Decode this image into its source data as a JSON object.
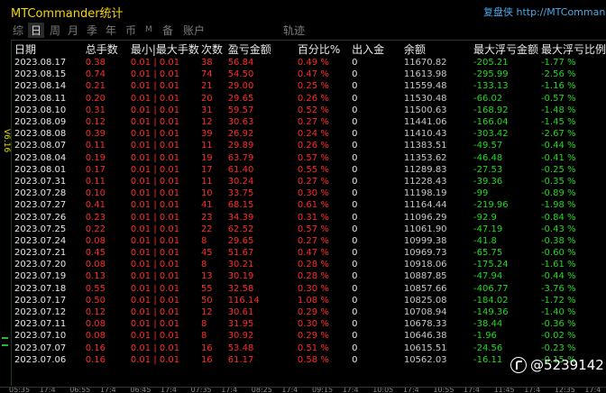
{
  "titlebar": {
    "app_title": "MTCommander统计",
    "replay_link": "复盘侠 http://MTCommander"
  },
  "tabs": [
    {
      "label": "综",
      "active": false
    },
    {
      "label": "日",
      "active": true
    },
    {
      "label": "周",
      "active": false
    },
    {
      "label": "月",
      "active": false
    },
    {
      "label": "季",
      "active": false
    },
    {
      "label": "年",
      "active": false
    },
    {
      "label": "币",
      "active": false
    },
    {
      "label": "M",
      "active": false
    },
    {
      "label": "备",
      "active": false
    },
    {
      "label": "账户",
      "active": false
    },
    {
      "label": "轨迹",
      "active": false
    }
  ],
  "left_strip_label": "V6.16",
  "table": {
    "headers": [
      "日期",
      "总手数",
      "最小|最大手数",
      "次数",
      "盈亏金额",
      "百分比%",
      "出入金",
      "余额",
      "最大浮亏金额",
      "最大浮亏比例"
    ],
    "rows": [
      [
        "2023.08.17",
        "0.38",
        "0.01 | 0.01",
        "38",
        "56.84",
        "0.49 %",
        "0",
        "11670.82",
        "-205.21",
        "-1.77 %"
      ],
      [
        "2023.08.15",
        "0.74",
        "0.01 | 0.01",
        "74",
        "54.50",
        "0.47 %",
        "0",
        "11613.98",
        "-295.99",
        "-2.56 %"
      ],
      [
        "2023.08.14",
        "0.21",
        "0.01 | 0.01",
        "21",
        "29.00",
        "0.25 %",
        "0",
        "11559.48",
        "-133.13",
        "-1.16 %"
      ],
      [
        "2023.08.11",
        "0.20",
        "0.01 | 0.01",
        "20",
        "29.65",
        "0.26 %",
        "0",
        "11530.48",
        "-66.02",
        "-0.57 %"
      ],
      [
        "2023.08.10",
        "0.31",
        "0.01 | 0.01",
        "31",
        "59.57",
        "0.52 %",
        "0",
        "11500.63",
        "-168.92",
        "-1.48 %"
      ],
      [
        "2023.08.09",
        "0.12",
        "0.01 | 0.01",
        "12",
        "30.63",
        "0.27 %",
        "0",
        "11441.06",
        "-166.04",
        "-1.45 %"
      ],
      [
        "2023.08.08",
        "0.39",
        "0.01 | 0.01",
        "39",
        "26.92",
        "0.24 %",
        "0",
        "11410.43",
        "-303.42",
        "-2.67 %"
      ],
      [
        "2023.08.07",
        "0.11",
        "0.01 | 0.01",
        "11",
        "29.89",
        "0.26 %",
        "0",
        "11383.51",
        "-49.57",
        "-0.44 %"
      ],
      [
        "2023.08.04",
        "0.19",
        "0.01 | 0.01",
        "19",
        "63.79",
        "0.57 %",
        "0",
        "11353.62",
        "-46.48",
        "-0.41 %"
      ],
      [
        "2023.08.01",
        "0.17",
        "0.01 | 0.01",
        "17",
        "61.40",
        "0.55 %",
        "0",
        "11289.83",
        "-27.53",
        "-0.25 %"
      ],
      [
        "2023.07.31",
        "0.11",
        "0.01 | 0.01",
        "11",
        "30.24",
        "0.27 %",
        "0",
        "11228.43",
        "-39.36",
        "-0.35 %"
      ],
      [
        "2023.07.28",
        "0.10",
        "0.01 | 0.01",
        "10",
        "33.75",
        "0.30 %",
        "0",
        "11198.19",
        "-99",
        "-0.89 %"
      ],
      [
        "2023.07.27",
        "0.41",
        "0.01 | 0.01",
        "41",
        "68.15",
        "0.61 %",
        "0",
        "11164.44",
        "-219.96",
        "-1.98 %"
      ],
      [
        "2023.07.26",
        "0.23",
        "0.01 | 0.01",
        "23",
        "34.39",
        "0.31 %",
        "0",
        "11096.29",
        "-92.9",
        "-0.84 %"
      ],
      [
        "2023.07.25",
        "0.22",
        "0.01 | 0.01",
        "22",
        "62.52",
        "0.57 %",
        "0",
        "11061.90",
        "-47.19",
        "-0.43 %"
      ],
      [
        "2023.07.24",
        "0.08",
        "0.01 | 0.01",
        "8",
        "29.65",
        "0.27 %",
        "0",
        "10999.38",
        "-41.8",
        "-0.38 %"
      ],
      [
        "2023.07.21",
        "0.45",
        "0.01 | 0.01",
        "45",
        "51.67",
        "0.47 %",
        "0",
        "10969.73",
        "-65.75",
        "-0.60 %"
      ],
      [
        "2023.07.20",
        "0.08",
        "0.01 | 0.01",
        "8",
        "30.21",
        "0.28 %",
        "0",
        "10918.06",
        "-175.24",
        "-1.61 %"
      ],
      [
        "2023.07.19",
        "0.13",
        "0.01 | 0.01",
        "13",
        "30.19",
        "0.28 %",
        "0",
        "10887.85",
        "-47.94",
        "-0.44 %"
      ],
      [
        "2023.07.18",
        "0.55",
        "0.01 | 0.01",
        "55",
        "32.58",
        "0.30 %",
        "0",
        "10857.66",
        "-406.77",
        "-3.76 %"
      ],
      [
        "2023.07.17",
        "0.50",
        "0.01 | 0.01",
        "50",
        "116.14",
        "1.08 %",
        "0",
        "10825.08",
        "-184.02",
        "-1.72 %"
      ],
      [
        "2023.07.12",
        "0.12",
        "0.01 | 0.01",
        "12",
        "30.61",
        "0.29 %",
        "0",
        "10708.94",
        "-149.36",
        "-1.40 %"
      ],
      [
        "2023.07.11",
        "0.08",
        "0.01 | 0.01",
        "8",
        "31.95",
        "0.30 %",
        "0",
        "10678.33",
        "-38.44",
        "-0.36 %"
      ],
      [
        "2023.07.10",
        "0.08",
        "0.01 | 0.01",
        "8",
        "30.92",
        "0.29 %",
        "0",
        "10646.38",
        "-1.96",
        "-0.02 %"
      ],
      [
        "2023.07.07",
        "0.16",
        "0.01 | 0.01",
        "16",
        "53.48",
        "0.51 %",
        "0",
        "10615.51",
        "-24.56",
        "-0.23 %"
      ],
      [
        "2023.07.06",
        "0.16",
        "0.01 | 0.01",
        "16",
        "61.17",
        "0.58 %",
        "0",
        "10562.03",
        "-16.11",
        "-0.15 %"
      ]
    ]
  },
  "time_axis": [
    "05:35",
    "17:4",
    "06:55",
    "17:4",
    "06:45",
    "17:4",
    "07:35",
    "17:4",
    "08:25",
    "17:4",
    "09:15",
    "17:4",
    "10:05",
    "17:4",
    "10:55",
    "17:4",
    "11:45",
    "17:4",
    "12:35",
    "17:4"
  ],
  "watermark": "@5239142",
  "colors": {
    "title": "#f5d40a",
    "link": "#4aa8e8",
    "profit": "#ff2a2a",
    "drawdown": "#21d821",
    "background": "#000000"
  }
}
